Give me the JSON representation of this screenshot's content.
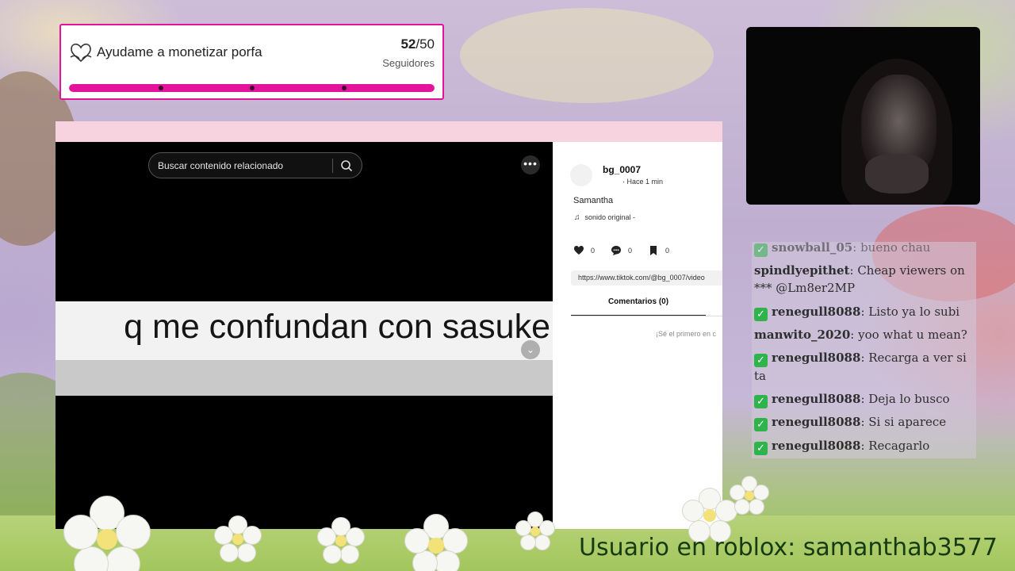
{
  "goal": {
    "title": "Ayudame a monetizar porfa",
    "current": "52",
    "target": "/50",
    "subtitle": "Seguidores",
    "progress": 1.0,
    "accent": "#e3139c"
  },
  "browser": {
    "search_placeholder": "Buscar contenido relacionado",
    "more_label": "•••",
    "banner_text": "q me confundan con sasuke",
    "down_label": "⌄"
  },
  "post": {
    "username": "bg_0007",
    "posted": "· Hace 1 min",
    "description": "Samantha",
    "music": "sonido original -",
    "likes": "0",
    "comments": "0",
    "saves": "0",
    "link": "https://www.tiktok.com/@bg_0007/video",
    "comments_tab": "Comentarios (0)",
    "first_comment": "¡Sé el primero en c"
  },
  "chat": {
    "badge_color": "#2fb34b",
    "messages": [
      {
        "user": "snowball_05",
        "sep": ":",
        "text": "bueno chau",
        "badge": true
      },
      {
        "user": "spindlyepithet",
        "sep": ":",
        "text": "Cheap viewers on *** @Lm8er2MP",
        "badge": false
      },
      {
        "user": "renegull8088",
        "sep": ":",
        "text": "Listo ya lo subi",
        "badge": true
      },
      {
        "user": "manwito_2020",
        "sep": ":",
        "text": "yoo what u mean?",
        "badge": false
      },
      {
        "user": "renegull8088",
        "sep": ":",
        "text": "Recarga a ver si ta",
        "badge": true
      },
      {
        "user": "renegull8088",
        "sep": ":",
        "text": "Deja lo busco",
        "badge": true
      },
      {
        "user": "renegull8088",
        "sep": ":",
        "text": "Si si aparece",
        "badge": true
      },
      {
        "user": "renegull8088",
        "sep": ":",
        "text": "Recagarlo",
        "badge": true
      }
    ]
  },
  "footer": {
    "roblox": "Usuario en roblox: samanthab3577"
  }
}
